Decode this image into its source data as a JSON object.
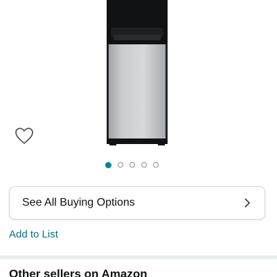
{
  "product": {
    "image_description": "water-dispenser-image"
  },
  "wishlist": {
    "icon": "heart-outline-icon"
  },
  "carousel": {
    "dot_count": 5,
    "active_index": 0
  },
  "buying_options": {
    "label": "See All Buying Options",
    "icon": "chevron-right-icon"
  },
  "add_to_list": {
    "label": "Add to List"
  },
  "other_sellers": {
    "heading": "Other sellers on Amazon"
  },
  "colors": {
    "link": "#007185",
    "active_dot": "#00838f",
    "text": "#0f1111"
  }
}
